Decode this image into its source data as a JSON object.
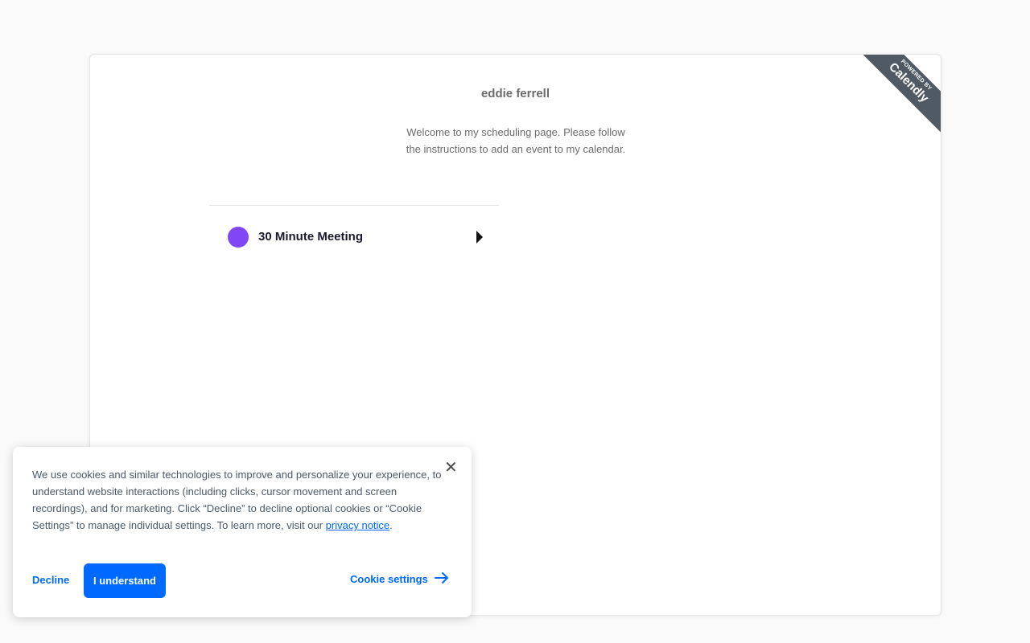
{
  "profile": {
    "name": "eddie ferrell",
    "welcome": "Welcome to my scheduling page. Please follow the instructions to add an event to my calendar."
  },
  "badge": {
    "small_text": "POWERED BY",
    "brand_text": "Calendly",
    "color": "#4f5a64"
  },
  "events": [
    {
      "label": "30 Minute Meeting",
      "color": "#8247f5",
      "icon": "chevron-right-icon"
    }
  ],
  "cookie_banner": {
    "text": "We use cookies and similar technologies to improve and personalize your experience, to understand website interactions (including clicks, cursor movement and screen recordings), and for marketing. Click “Decline” to decline optional cookies or “Cookie Settings” to manage individual settings. To learn more, visit our ",
    "link_text": "privacy notice",
    "text_end": ".",
    "close_icon": "close-icon",
    "decline_label": "Decline",
    "accept_label": "I understand",
    "settings_label": "Cookie settings",
    "settings_icon": "arrow-right-icon",
    "accent_color": "#0069ff"
  }
}
